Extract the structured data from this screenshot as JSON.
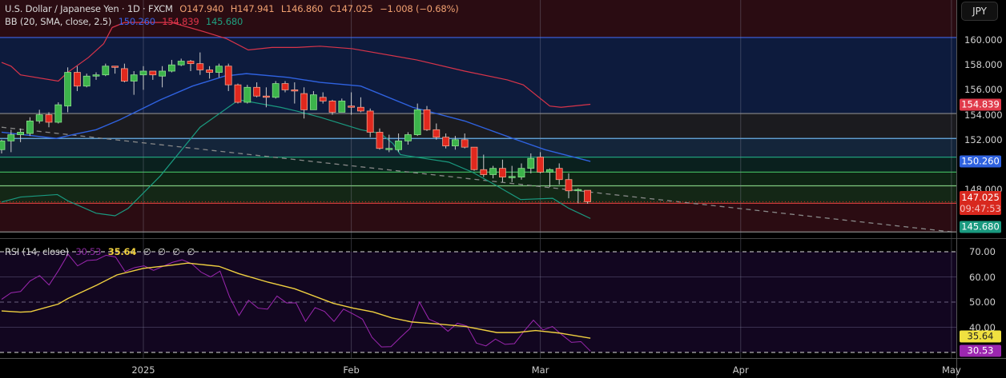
{
  "header": {
    "symbol": "U.S. Dollar / Japanese Yen · 1D · FXCM",
    "open": "O147.940",
    "high": "H147.941",
    "low": "L146.860",
    "close": "C147.025",
    "change": "−1.008 (−0.68%)"
  },
  "bb_legend": {
    "label": "BB (20, SMA, close, 2.5)",
    "basis": "150.260",
    "upper": "154.839",
    "lower": "145.680"
  },
  "rsi_legend": {
    "label": "RSI (14, close)",
    "rsi": "30.53",
    "ma": "35.64",
    "extra": [
      "∅",
      "∅",
      "∅",
      "∅"
    ]
  },
  "currency_button": "JPY",
  "price_axis": [
    "160.000",
    "158.000",
    "156.000",
    "154.000",
    "152.000",
    "148.000"
  ],
  "price_axis_values": [
    160,
    158,
    156,
    154,
    152,
    148
  ],
  "price_tags": {
    "upper": "154.839",
    "basis": "150.260",
    "last": "147.025",
    "countdown": "09:47:53",
    "lower": "145.680"
  },
  "rsi_axis": [
    "70.00",
    "60.00",
    "50.00",
    "40.00"
  ],
  "rsi_axis_values": [
    70,
    60,
    50,
    40
  ],
  "rsi_tags": {
    "ma": "35.64",
    "rsi": "30.53"
  },
  "time_axis": [
    "2025",
    "Feb",
    "Mar",
    "Apr",
    "May"
  ],
  "time_axis_bar_index": [
    15,
    37,
    57,
    78.2,
    100.5
  ],
  "colors": {
    "up": "#3cb44b",
    "down": "#e0281e",
    "basis": "#2f62e0",
    "upper": "#d8344a",
    "lower": "#1a9a80",
    "rsi": "#9c27b0",
    "rsi_ma": "#f0d040",
    "last": "#d8281e"
  },
  "chart_data": {
    "type": "candlestick",
    "symbol": "USDJPY",
    "ylim": [
      144.1,
      163.2
    ],
    "candles": [
      [
        151.2,
        151.9,
        152.0,
        150.9
      ],
      [
        151.9,
        152.4,
        152.8,
        151.0
      ],
      [
        152.4,
        152.6,
        152.9,
        151.8
      ],
      [
        152.5,
        153.5,
        153.8,
        152.3
      ],
      [
        153.5,
        154.0,
        154.4,
        153.3
      ],
      [
        154.0,
        153.4,
        154.2,
        153.0
      ],
      [
        153.4,
        154.8,
        155.0,
        153.3
      ],
      [
        154.7,
        157.4,
        157.8,
        154.2
      ],
      [
        157.4,
        156.3,
        157.9,
        155.9
      ],
      [
        156.3,
        157.1,
        157.3,
        156.2
      ],
      [
        157.1,
        157.2,
        157.4,
        156.8
      ],
      [
        157.2,
        157.9,
        158.1,
        157.1
      ],
      [
        157.9,
        157.8,
        157.9,
        157.3
      ],
      [
        157.7,
        156.7,
        158.1,
        156.6
      ],
      [
        156.7,
        157.2,
        157.5,
        155.6
      ],
      [
        157.2,
        157.5,
        157.9,
        156.0
      ],
      [
        157.5,
        157.2,
        157.5,
        156.8
      ],
      [
        157.1,
        157.5,
        157.9,
        156.2
      ],
      [
        157.5,
        158.0,
        158.4,
        157.4
      ],
      [
        158.0,
        158.3,
        158.5,
        157.9
      ],
      [
        158.3,
        158.1,
        158.4,
        157.5
      ],
      [
        158.1,
        157.6,
        159.0,
        157.2
      ],
      [
        157.6,
        157.4,
        157.9,
        156.9
      ],
      [
        157.4,
        157.9,
        158.1,
        157.0
      ],
      [
        157.9,
        156.4,
        158.1,
        155.9
      ],
      [
        156.4,
        155.0,
        156.5,
        154.9
      ],
      [
        155.0,
        156.2,
        156.4,
        154.9
      ],
      [
        156.2,
        155.5,
        156.6,
        155.4
      ],
      [
        155.5,
        155.4,
        156.2,
        154.6
      ],
      [
        155.4,
        156.5,
        156.7,
        155.3
      ],
      [
        156.5,
        156.0,
        156.7,
        155.8
      ],
      [
        156.0,
        155.95,
        156.6,
        154.9
      ],
      [
        155.7,
        154.4,
        156.2,
        153.7
      ],
      [
        154.4,
        155.6,
        155.9,
        154.4
      ],
      [
        155.4,
        155.1,
        155.8,
        154.9
      ],
      [
        155.1,
        154.2,
        155.2,
        154.0
      ],
      [
        154.2,
        155.1,
        155.3,
        154.4
      ],
      [
        154.7,
        154.6,
        155.8,
        154.0
      ],
      [
        154.6,
        154.3,
        155.4,
        154.2
      ],
      [
        154.3,
        152.6,
        154.5,
        152.2
      ],
      [
        152.6,
        151.3,
        152.9,
        151.2
      ],
      [
        151.3,
        151.3,
        152.4,
        151.0
      ],
      [
        151.2,
        151.9,
        152.5,
        151.0
      ],
      [
        151.9,
        152.4,
        152.6,
        151.6
      ],
      [
        152.4,
        154.4,
        154.9,
        152.3
      ],
      [
        154.4,
        152.8,
        154.7,
        152.7
      ],
      [
        152.8,
        152.2,
        153.3,
        152.0
      ],
      [
        152.2,
        151.5,
        152.5,
        151.3
      ],
      [
        151.5,
        152.0,
        152.3,
        151.2
      ],
      [
        152.0,
        151.4,
        152.5,
        151.3
      ],
      [
        151.4,
        149.6,
        151.4,
        149.5
      ],
      [
        149.6,
        149.2,
        150.8,
        149.0
      ],
      [
        149.2,
        149.7,
        149.9,
        148.9
      ],
      [
        149.7,
        149.0,
        150.4,
        148.6
      ],
      [
        149.0,
        149.05,
        149.9,
        148.6
      ],
      [
        149.0,
        149.7,
        150.1,
        148.8
      ],
      [
        149.7,
        150.5,
        150.9,
        149.3
      ],
      [
        150.6,
        149.4,
        151.0,
        149.3
      ],
      [
        149.4,
        149.6,
        149.7,
        148.2
      ],
      [
        149.7,
        148.8,
        150.1,
        148.4
      ],
      [
        148.8,
        147.9,
        149.3,
        147.3
      ],
      [
        148.0,
        148.0,
        148.1,
        146.9
      ],
      [
        147.94,
        147.025,
        147.94,
        146.86
      ]
    ],
    "bb_upper": [
      [
        0,
        158.2
      ],
      [
        1,
        157.9
      ],
      [
        2,
        157.2
      ],
      [
        6,
        156.7
      ],
      [
        7,
        157.4
      ],
      [
        9.2,
        158.6
      ],
      [
        10.8,
        159.7
      ],
      [
        11.7,
        161.0
      ],
      [
        13,
        161.4
      ],
      [
        18,
        161.4
      ],
      [
        21.7,
        160.6
      ],
      [
        23.8,
        160.1
      ],
      [
        26.1,
        159.2
      ],
      [
        28.6,
        159.4
      ],
      [
        31.2,
        159.4
      ],
      [
        33.7,
        159.5
      ],
      [
        37.1,
        159.3
      ],
      [
        43.9,
        158.4
      ],
      [
        49,
        157.5
      ],
      [
        53.5,
        156.8
      ],
      [
        55.2,
        156.4
      ],
      [
        58,
        154.7
      ],
      [
        59.2,
        154.6
      ],
      [
        62.3,
        154.84
      ]
    ],
    "bb_basis": [
      [
        0,
        152.6
      ],
      [
        5.8,
        152.1
      ],
      [
        7.5,
        152.4
      ],
      [
        10,
        152.8
      ],
      [
        12.5,
        153.6
      ],
      [
        16.8,
        155.2
      ],
      [
        20.2,
        156.3
      ],
      [
        23.6,
        157.1
      ],
      [
        25.9,
        157.3
      ],
      [
        30.3,
        157.0
      ],
      [
        33.7,
        156.6
      ],
      [
        38,
        156.3
      ],
      [
        43.5,
        154.6
      ],
      [
        49,
        153.5
      ],
      [
        54.1,
        152.1
      ],
      [
        57.5,
        151.2
      ],
      [
        62.3,
        150.26
      ]
    ],
    "bb_lower": [
      [
        0,
        147.0
      ],
      [
        2,
        147.4
      ],
      [
        5.9,
        147.6
      ],
      [
        7,
        147.1
      ],
      [
        10,
        146.1
      ],
      [
        12,
        145.9
      ],
      [
        13.4,
        146.5
      ],
      [
        16.8,
        149.1
      ],
      [
        21,
        153.0
      ],
      [
        25.1,
        155.2
      ],
      [
        29.5,
        154.6
      ],
      [
        31.2,
        154.3
      ],
      [
        33.7,
        153.8
      ],
      [
        38,
        152.8
      ],
      [
        40.1,
        152.5
      ],
      [
        41.4,
        151.7
      ],
      [
        42.2,
        150.8
      ],
      [
        44.7,
        150.5
      ],
      [
        47.3,
        150.2
      ],
      [
        49.8,
        149.4
      ],
      [
        52.4,
        148.3
      ],
      [
        54.9,
        147.2
      ],
      [
        58.3,
        147.3
      ],
      [
        60,
        146.5
      ],
      [
        62.3,
        145.68
      ]
    ],
    "trendline": [
      [
        0,
        153.0
      ],
      [
        100.6,
        144.6
      ]
    ],
    "zone_levels": [
      160.2,
      154.1,
      152.1,
      150.6,
      149.4,
      148.3,
      146.9,
      144.6
    ],
    "zone_line_colors": [
      "#3a5bd0",
      "#8a8a8a",
      "#6ab0e8",
      "#1f9e7a",
      "#3fae5a",
      "#7ec87e",
      "#d03a3a",
      "#8a8a8a"
    ],
    "zone_fills": [
      "#2a0c12",
      "#0d1b3d",
      "#1b1b1f",
      "#14253a",
      "#0a201e",
      "#0e2414",
      "#142716",
      "#2b0c12"
    ],
    "rsi": {
      "ylim": [
        28,
        75
      ],
      "levels": [
        70,
        50,
        30
      ],
      "values": [
        51.1,
        53.7,
        54.2,
        58.4,
        60.5,
        56.8,
        62.6,
        69,
        64.4,
        66.5,
        66.8,
        68.6,
        67.9,
        62.1,
        63.7,
        64.4,
        62.6,
        64.2,
        65.8,
        66.8,
        65.3,
        61.9,
        60,
        62.3,
        52.1,
        44.7,
        50.7,
        47.6,
        47.2,
        52.4,
        49.7,
        49.7,
        42.3,
        47.8,
        46.3,
        42.3,
        47.2,
        45.3,
        43.2,
        36,
        32.2,
        32.3,
        36,
        39.5,
        50,
        43.2,
        41.6,
        38.4,
        41.6,
        40.5,
        33.7,
        32.6,
        35.3,
        33.2,
        33.5,
        38.4,
        42.8,
        38.9,
        40.3,
        37,
        34,
        34.3,
        30.53
      ],
      "ma": [
        [
          0,
          46.5
        ],
        [
          2,
          46
        ],
        [
          3.1,
          46.2
        ],
        [
          6,
          49.2
        ],
        [
          7,
          51.4
        ],
        [
          10.1,
          56.8
        ],
        [
          12.2,
          60.8
        ],
        [
          15,
          63.4
        ],
        [
          18.1,
          64.7
        ],
        [
          19.7,
          65.5
        ],
        [
          21.2,
          64.9
        ],
        [
          23,
          64.2
        ],
        [
          25.1,
          61.3
        ],
        [
          28.2,
          57.9
        ],
        [
          31,
          55.3
        ],
        [
          35.1,
          49.5
        ],
        [
          37.2,
          47.6
        ],
        [
          39.3,
          46.1
        ],
        [
          41.3,
          43.7
        ],
        [
          43.4,
          42.1
        ],
        [
          46.2,
          41.3
        ],
        [
          49.1,
          40.3
        ],
        [
          52.4,
          37.9
        ],
        [
          54.5,
          37.9
        ],
        [
          56.5,
          38.7
        ],
        [
          59,
          37.7
        ],
        [
          62.3,
          35.64
        ]
      ]
    }
  }
}
